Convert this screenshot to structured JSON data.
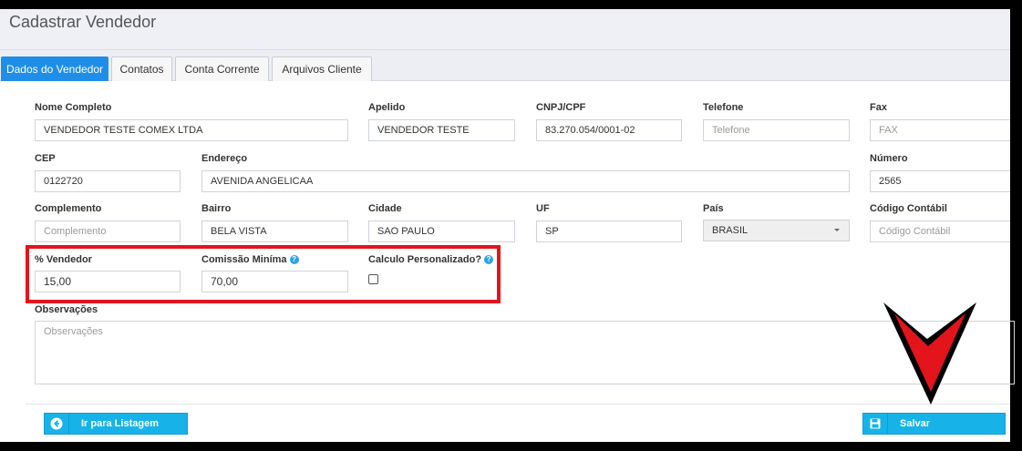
{
  "page": {
    "title": "Cadastrar Vendedor"
  },
  "tabs": [
    {
      "label": "Dados do Vendedor",
      "active": true
    },
    {
      "label": "Contatos",
      "active": false
    },
    {
      "label": "Conta Corrente",
      "active": false
    },
    {
      "label": "Arquivos Cliente",
      "active": false
    }
  ],
  "form": {
    "nome_completo": {
      "label": "Nome Completo",
      "value": "VENDEDOR TESTE COMEX LTDA"
    },
    "apelido": {
      "label": "Apelido",
      "value": "VENDEDOR TESTE"
    },
    "cnpj_cpf": {
      "label": "CNPJ/CPF",
      "value": "83.270.054/0001-02"
    },
    "telefone": {
      "label": "Telefone",
      "placeholder": "Telefone"
    },
    "fax": {
      "label": "Fax",
      "placeholder": "FAX"
    },
    "cep": {
      "label": "CEP",
      "value": "0122720"
    },
    "endereco": {
      "label": "Endereço",
      "value": "AVENIDA ANGELICAA"
    },
    "numero": {
      "label": "Número",
      "value": "2565"
    },
    "complemento": {
      "label": "Complemento",
      "placeholder": "Complemento"
    },
    "bairro": {
      "label": "Bairro",
      "value": "BELA VISTA"
    },
    "cidade": {
      "label": "Cidade",
      "value": "SAO PAULO"
    },
    "uf": {
      "label": "UF",
      "value": "SP"
    },
    "pais": {
      "label": "País",
      "value": "BRASIL"
    },
    "codigo_contabil": {
      "label": "Código Contábil",
      "placeholder": "Código Contábil"
    },
    "percent_vendedor": {
      "label": "% Vendedor",
      "value": "15,00"
    },
    "comissao_minima": {
      "label": "Comissão Miníma",
      "value": "70,00"
    },
    "calculo_personalizado": {
      "label": "Calculo Personalizado?",
      "checked": false
    },
    "observacoes": {
      "label": "Observações",
      "placeholder": "Observações"
    }
  },
  "buttons": {
    "back_label": "Ir para Listagem",
    "save_label": "Salvar"
  },
  "colors": {
    "accent": "#1f8ee8",
    "button": "#17b3e8",
    "highlight": "#e3141b",
    "annotation_arrow": "#e3141b"
  },
  "icons": {
    "help": "question-circle-icon",
    "back": "arrow-left-circle-icon",
    "save": "floppy-disk-icon",
    "annotation": "red-down-arrow-icon"
  }
}
